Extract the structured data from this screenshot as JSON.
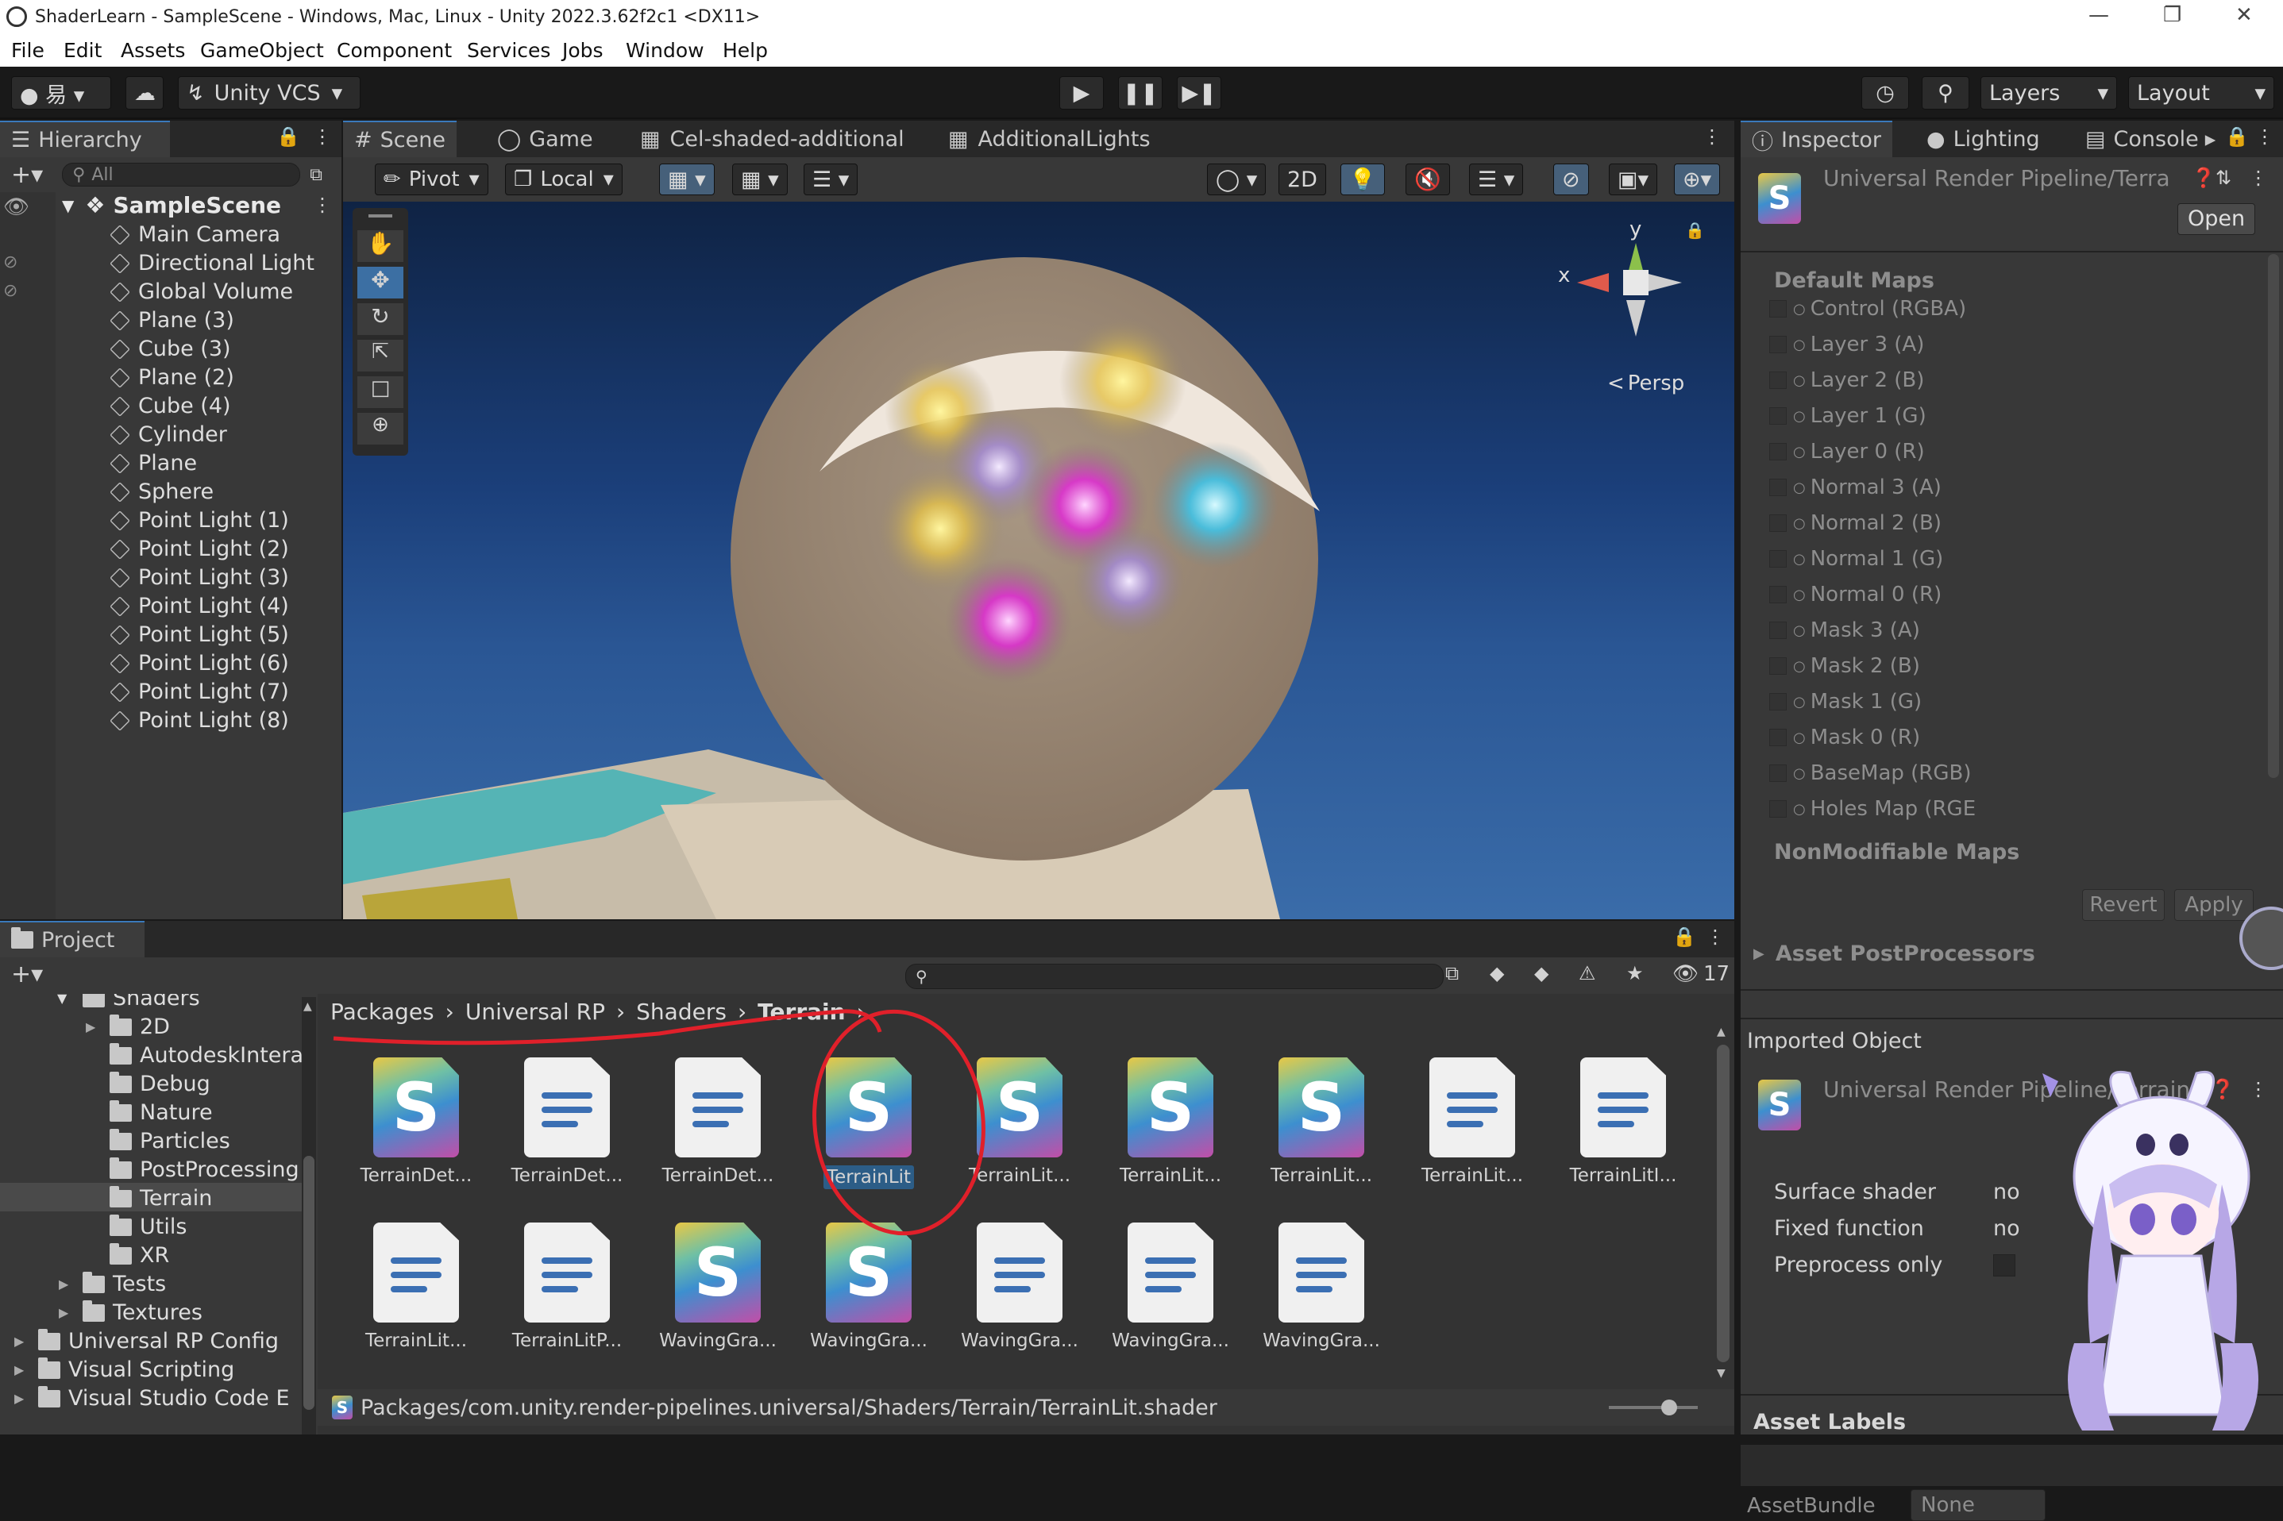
{
  "window": {
    "title": "ShaderLearn - SampleScene - Windows, Mac, Linux - Unity 2022.3.62f2c1 <DX11>"
  },
  "menu": [
    "File",
    "Edit",
    "Assets",
    "GameObject",
    "Component",
    "Services",
    "Jobs",
    "Window",
    "Help"
  ],
  "toolbar": {
    "vcs_label": "Unity VCS",
    "layers_label": "Layers",
    "layout_label": "Layout"
  },
  "hierarchy": {
    "tab_label": "Hierarchy",
    "search_placeholder": "All",
    "scene_name": "SampleScene",
    "items": [
      "Main Camera",
      "Directional Light",
      "Global Volume",
      "Plane (3)",
      "Cube (3)",
      "Plane (2)",
      "Cube (4)",
      "Cylinder",
      "Plane",
      "Sphere",
      "Point Light (1)",
      "Point Light (2)",
      "Point Light (3)",
      "Point Light (4)",
      "Point Light (5)",
      "Point Light (6)",
      "Point Light (7)",
      "Point Light (8)"
    ]
  },
  "scene_tabs": [
    "Scene",
    "Game",
    "Cel-shaded-additional",
    "AdditionalLights"
  ],
  "scene_toolbar": {
    "pivot": "Pivot",
    "local": "Local",
    "two_d": "2D"
  },
  "gizmo": {
    "y": "y",
    "x": "x",
    "persp": "Persp"
  },
  "inspector": {
    "tabs": [
      "Inspector",
      "Lighting",
      "Console"
    ],
    "asset_title": "Universal Render Pipeline/Terra",
    "open_button": "Open",
    "section_default_maps": "Default Maps",
    "maps": [
      "Control (RGBA)",
      "Layer 3 (A)",
      "Layer 2 (B)",
      "Layer 1 (G)",
      "Layer 0 (R)",
      "Normal 3 (A)",
      "Normal 2 (B)",
      "Normal 1 (G)",
      "Normal 0 (R)",
      "Mask 3 (A)",
      "Mask 2 (B)",
      "Mask 1 (G)",
      "Mask 0 (R)",
      "BaseMap (RGB)",
      "Holes Map (RGE"
    ],
    "section_nonmodifiable": "NonModifiable Maps",
    "revert": "Revert",
    "apply": "Apply",
    "asset_postprocessors": "Asset PostProcessors",
    "imported_object": "Imported Object",
    "imported_title": "Universal Render Pipeline/Terrain",
    "props": [
      {
        "label": "Surface shader",
        "value": "no"
      },
      {
        "label": "Fixed function",
        "value": "no"
      },
      {
        "label": "Preprocess only",
        "value": ""
      }
    ],
    "asset_labels": "Asset Labels",
    "assetbundle_label": "AssetBundle",
    "assetbundle_value": "None"
  },
  "project": {
    "tab_label": "Project",
    "count": "17",
    "tree": [
      {
        "label": "Shaders",
        "indent": 0
      },
      {
        "label": "2D",
        "indent": 1
      },
      {
        "label": "AutodeskInterac",
        "indent": 1
      },
      {
        "label": "Debug",
        "indent": 1
      },
      {
        "label": "Nature",
        "indent": 1
      },
      {
        "label": "Particles",
        "indent": 1
      },
      {
        "label": "PostProcessing",
        "indent": 1
      },
      {
        "label": "Terrain",
        "indent": 1
      },
      {
        "label": "Utils",
        "indent": 1
      },
      {
        "label": "XR",
        "indent": 1
      },
      {
        "label": "Tests",
        "indent": 0
      },
      {
        "label": "Textures",
        "indent": 0
      },
      {
        "label": "Universal RP Config",
        "indent": -1
      },
      {
        "label": "Visual Scripting",
        "indent": -1
      },
      {
        "label": "Visual Studio Code E",
        "indent": -1
      }
    ],
    "breadcrumb": [
      "Packages",
      "Universal RP",
      "Shaders",
      "Terrain"
    ],
    "assets": [
      {
        "label": "TerrainDet...",
        "kind": "shader"
      },
      {
        "label": "TerrainDet...",
        "kind": "doc"
      },
      {
        "label": "TerrainDet...",
        "kind": "doc"
      },
      {
        "label": "TerrainLit",
        "kind": "shader",
        "selected": true
      },
      {
        "label": "TerrainLit...",
        "kind": "shader"
      },
      {
        "label": "TerrainLit...",
        "kind": "shader"
      },
      {
        "label": "TerrainLit...",
        "kind": "shader"
      },
      {
        "label": "TerrainLit...",
        "kind": "doc"
      },
      {
        "label": "TerrainLitI...",
        "kind": "doc"
      },
      {
        "label": "TerrainLit...",
        "kind": "doc"
      },
      {
        "label": "TerrainLitP...",
        "kind": "doc"
      },
      {
        "label": "WavingGra...",
        "kind": "shader"
      },
      {
        "label": "WavingGra...",
        "kind": "shader"
      },
      {
        "label": "WavingGra...",
        "kind": "doc"
      },
      {
        "label": "WavingGra...",
        "kind": "doc"
      },
      {
        "label": "WavingGra...",
        "kind": "doc"
      }
    ],
    "status_path": "Packages/com.unity.render-pipelines.universal/Shaders/Terrain/TerrainLit.shader"
  },
  "colors": {
    "accent": "#3a79bb",
    "annotation": "#e0202a",
    "selection": "#2c5d87"
  }
}
